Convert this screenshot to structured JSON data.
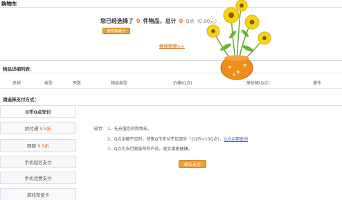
{
  "cart": {
    "title": "购物车",
    "summary_prefix": "您已经选择了",
    "item_count": "0",
    "summary_mid": "件物品，总计",
    "total": "0",
    "summary_unit": "Q点（0.00元）",
    "clear_button": "清空购物车",
    "continue_link": "继续购物>>"
  },
  "details": {
    "title": "物品详细列表：",
    "columns": [
      "名称",
      "类型",
      "天数",
      "物品类型",
      "价格(Q点)",
      "原价格(Q点)",
      "操作"
    ]
  },
  "payment": {
    "title": "请选择支付方式：",
    "active_method": "Q币Q点支付",
    "methods": [
      {
        "label": "财付通",
        "badge": "9.5折"
      },
      {
        "label": "网银",
        "badge": "9.5折"
      },
      {
        "label": "手机短信支付",
        "badge": ""
      },
      {
        "label": "手机话费支付",
        "badge": ""
      },
      {
        "label": "游戏充值卡",
        "badge": ""
      }
    ],
    "note_label": "说明：",
    "notes": [
      "1、先充值您的购物车。",
      "2、Q点余额不足时，使用Q币支付不足部分（1Q币=10Q点）",
      "3、Q点可支付商城所有产品，更实惠更便捷。"
    ],
    "note_link": "Q点余额查询",
    "confirm_button": "确认支付"
  },
  "colors": {
    "accent_orange": "#e87800",
    "button_orange": "#e9a23a",
    "link_blue": "#3a65b8"
  }
}
